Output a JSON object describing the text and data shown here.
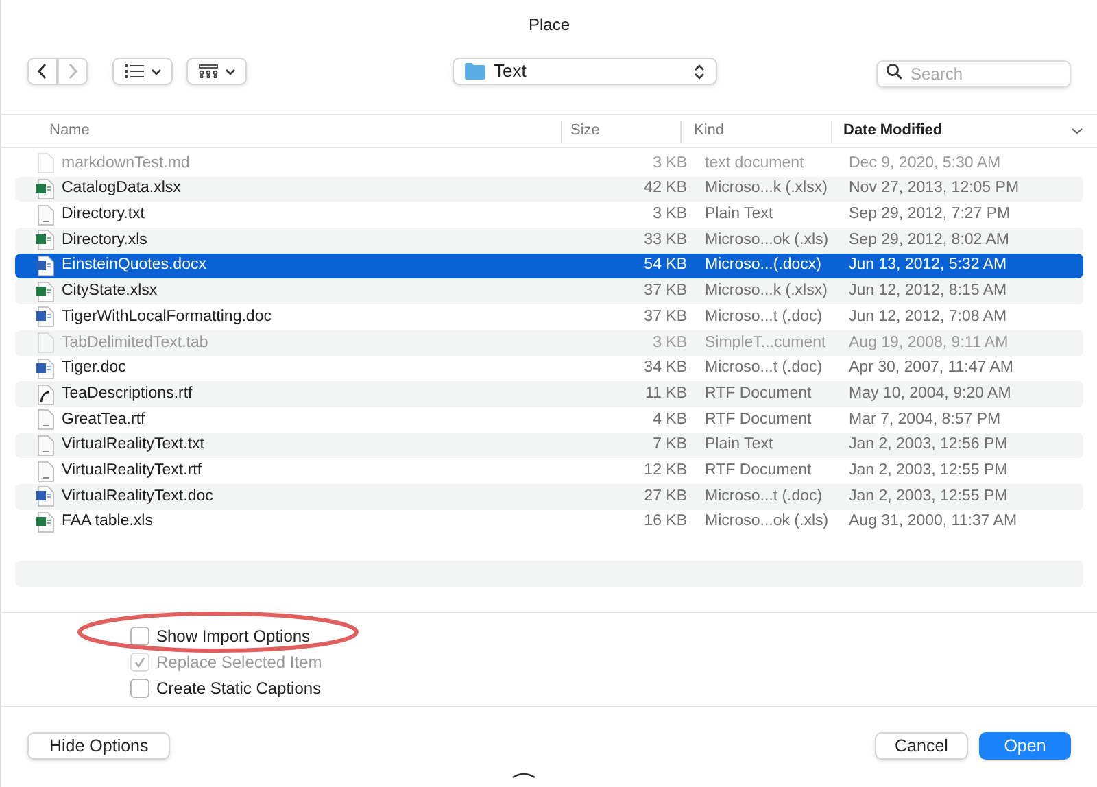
{
  "window": {
    "title": "Place"
  },
  "toolbar": {
    "location": "Text",
    "search": {
      "placeholder": "Search"
    }
  },
  "table": {
    "columns": [
      {
        "label": "Name",
        "sorted": false
      },
      {
        "label": "Size",
        "sorted": false
      },
      {
        "label": "Kind",
        "sorted": false
      },
      {
        "label": "Date Modified",
        "sorted": true
      }
    ],
    "rows": [
      {
        "kind": "plain",
        "name": "markdownTest.md",
        "size": "3 KB",
        "type": "text document",
        "date": "Dec 9, 2020, 5:30 AM",
        "disabled": true,
        "selected": false
      },
      {
        "kind": "excel",
        "name": "CatalogData.xlsx",
        "size": "42 KB",
        "type": "Microso...k (.xlsx)",
        "date": "Nov 27, 2013, 12:05 PM",
        "disabled": false,
        "selected": false
      },
      {
        "kind": "text",
        "name": "Directory.txt",
        "size": "3 KB",
        "type": "Plain Text",
        "date": "Sep 29, 2012, 7:27 PM",
        "disabled": false,
        "selected": false
      },
      {
        "kind": "excel",
        "name": "Directory.xls",
        "size": "33 KB",
        "type": "Microso...ok (.xls)",
        "date": "Sep 29, 2012, 8:02 AM",
        "disabled": false,
        "selected": false
      },
      {
        "kind": "word",
        "name": "EinsteinQuotes.docx",
        "size": "54 KB",
        "type": "Microso...(.docx)",
        "date": "Jun 13, 2012, 5:32 AM",
        "disabled": false,
        "selected": true
      },
      {
        "kind": "excel",
        "name": "CityState.xlsx",
        "size": "37 KB",
        "type": "Microso...k (.xlsx)",
        "date": "Jun 12, 2012, 8:15 AM",
        "disabled": false,
        "selected": false
      },
      {
        "kind": "word",
        "name": "TigerWithLocalFormatting.doc",
        "size": "37 KB",
        "type": "Microso...t (.doc)",
        "date": "Jun 12, 2012, 7:08 AM",
        "disabled": false,
        "selected": false
      },
      {
        "kind": "plain",
        "name": "TabDelimitedText.tab",
        "size": "3 KB",
        "type": "SimpleT...cument",
        "date": "Aug 19, 2008, 9:11 AM",
        "disabled": true,
        "selected": false
      },
      {
        "kind": "word",
        "name": "Tiger.doc",
        "size": "34 KB",
        "type": "Microso...t (.doc)",
        "date": "Apr 30, 2007, 11:47 AM",
        "disabled": false,
        "selected": false
      },
      {
        "kind": "rtf",
        "name": "TeaDescriptions.rtf",
        "size": "11 KB",
        "type": "RTF Document",
        "date": "May 10, 2004, 9:20 AM",
        "disabled": false,
        "selected": false
      },
      {
        "kind": "text",
        "name": "GreatTea.rtf",
        "size": "4 KB",
        "type": "RTF Document",
        "date": "Mar 7, 2004, 8:57 PM",
        "disabled": false,
        "selected": false
      },
      {
        "kind": "text",
        "name": "VirtualRealityText.txt",
        "size": "7 KB",
        "type": "Plain Text",
        "date": "Jan 2, 2003, 12:56 PM",
        "disabled": false,
        "selected": false
      },
      {
        "kind": "text",
        "name": "VirtualRealityText.rtf",
        "size": "12 KB",
        "type": "RTF Document",
        "date": "Jan 2, 2003, 12:55 PM",
        "disabled": false,
        "selected": false
      },
      {
        "kind": "word",
        "name": "VirtualRealityText.doc",
        "size": "27 KB",
        "type": "Microso...t (.doc)",
        "date": "Jan 2, 2003, 12:55 PM",
        "disabled": false,
        "selected": false
      },
      {
        "kind": "excel",
        "name": "FAA table.xls",
        "size": "16 KB",
        "type": "Microso...ok (.xls)",
        "date": "Aug 31, 2000, 11:37 AM",
        "disabled": false,
        "selected": false
      }
    ]
  },
  "options": [
    {
      "label": "Show Import Options",
      "checked": false,
      "disabled": false
    },
    {
      "label": "Replace Selected Item",
      "checked": true,
      "disabled": true
    },
    {
      "label": "Create Static Captions",
      "checked": false,
      "disabled": false
    }
  ],
  "annotation": {
    "kind": "ellipse"
  },
  "buttons": {
    "left": "Hide Options",
    "cancel": "Cancel",
    "confirm": "Open"
  }
}
